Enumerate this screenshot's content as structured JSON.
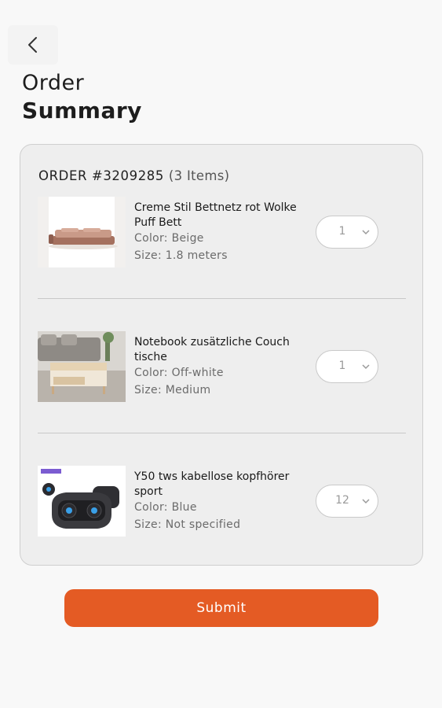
{
  "header": {
    "back_icon": "chevron-left-icon",
    "title_line1": "Order",
    "title_line2": "Summary"
  },
  "order": {
    "label": "ORDER #3209285",
    "count": "(3 Items)",
    "items": [
      {
        "name": "Creme Stil Bettnetz rot Wolke Puff Bett",
        "color": "Color: Beige",
        "size": "Size: 1.8 meters",
        "quantity": "1",
        "image": "bed-image"
      },
      {
        "name": "Notebook zusätzliche Couch tische",
        "color": "Color: Off-white",
        "size": "Size: Medium",
        "quantity": "1",
        "image": "coffee-table-image"
      },
      {
        "name": "Y50 tws kabellose kopfhörer sport",
        "color": "Color: Blue",
        "size": "Size: Not specified",
        "quantity": "12",
        "image": "earbuds-image"
      }
    ]
  },
  "actions": {
    "submit_label": "Submit"
  },
  "colors": {
    "accent": "#e45b24",
    "background": "#f8f8f8",
    "card": "#eeeeee"
  }
}
